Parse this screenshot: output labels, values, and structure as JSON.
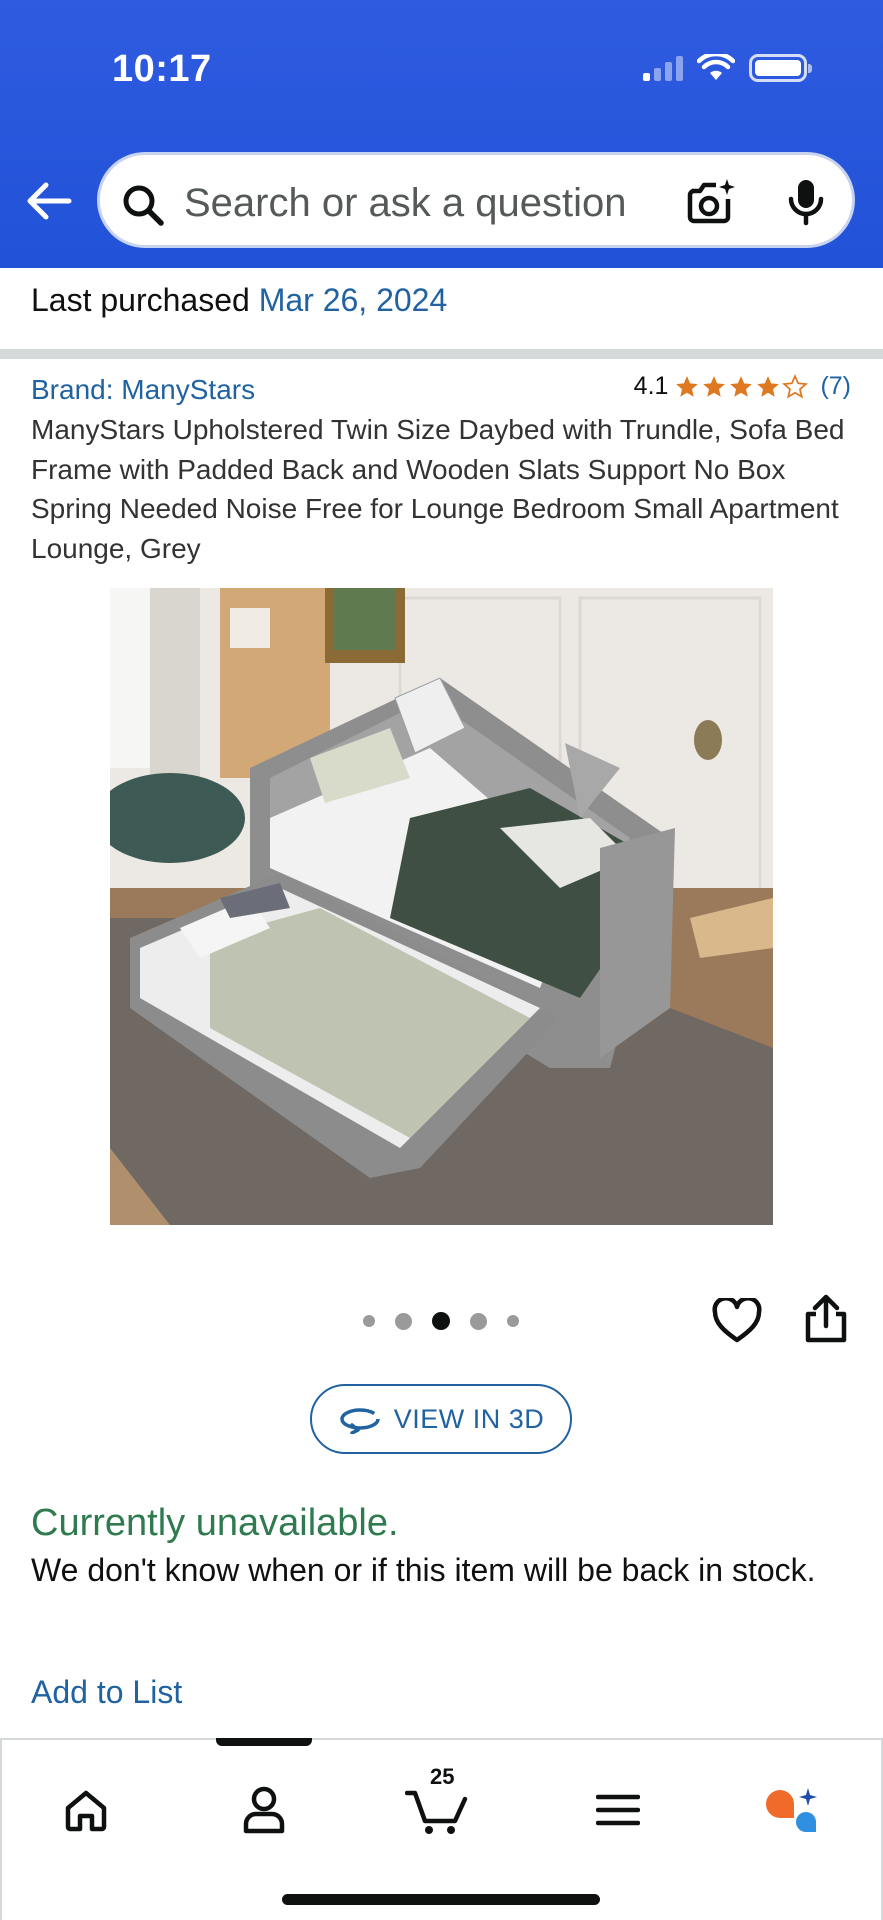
{
  "status_bar": {
    "time": "10:17",
    "icons": [
      "cellular-signal-icon",
      "wifi-icon",
      "battery-icon"
    ]
  },
  "search": {
    "placeholder": "Search or ask a question",
    "icons": [
      "back-arrow-icon",
      "search-icon",
      "camera-lens-icon",
      "microphone-icon"
    ]
  },
  "purchase": {
    "label": "Last purchased",
    "date": "Mar 26, 2024"
  },
  "product": {
    "brand": "Brand: ManyStars",
    "rating": "4.1",
    "rating_value": 4.1,
    "rating_max": 5,
    "review_count": "(7)",
    "title": "ManyStars Upholstered Twin Size Daybed with Trundle, Sofa Bed Frame with Padded Back and Wooden Slats Support No Box Spring Needed Noise Free for Lounge Bedroom Small Apartment Lounge, Grey",
    "image_count": 5,
    "active_image_index": 2
  },
  "actions": {
    "view_3d": "VIEW IN 3D",
    "add_to_list": "Add to List",
    "icons": [
      "heart-icon",
      "share-icon",
      "rotate-3d-icon"
    ]
  },
  "availability": {
    "status": "Currently unavailable.",
    "message": "We don't know when or if this item will be back in stock."
  },
  "bottom_nav": {
    "items": [
      "home-icon",
      "account-icon",
      "cart-icon",
      "menu-icon",
      "rufus-assistant-icon"
    ],
    "cart_count": "25",
    "active_index": 1
  },
  "colors": {
    "header_blue": "#2152d8",
    "link_blue": "#2162a1",
    "star_orange": "#de7921",
    "unavailable_green": "#2f7a4f"
  }
}
